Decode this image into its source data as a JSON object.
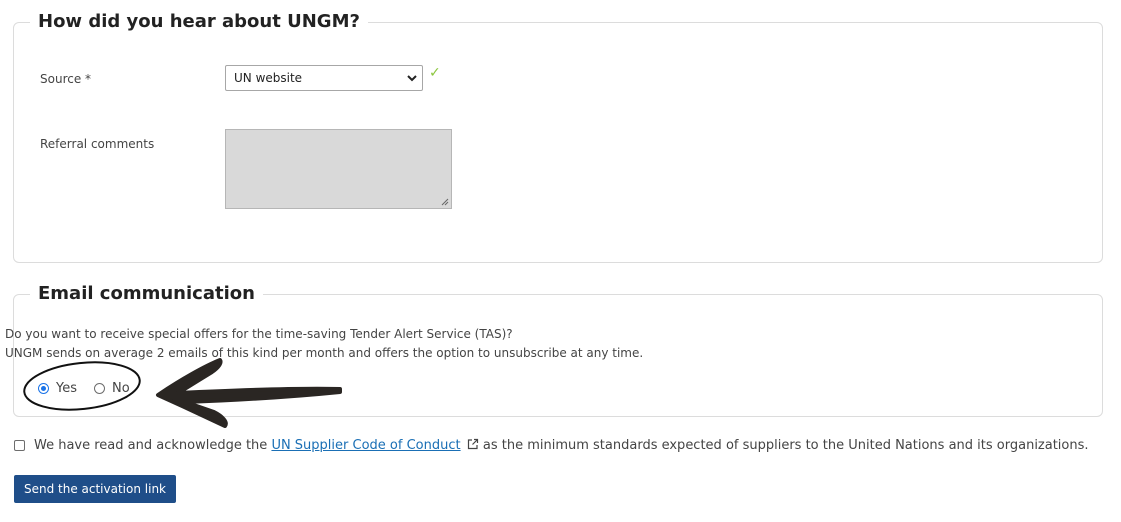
{
  "hear_section": {
    "legend": "How did you hear about UNGM?",
    "source_label": "Source *",
    "source_value": "UN website",
    "referral_label": "Referral comments",
    "referral_value": ""
  },
  "email_section": {
    "legend": "Email communication",
    "question_line1": "Do you want to receive special offers for the time-saving Tender Alert Service (TAS)?",
    "question_line2": "UNGM sends on average 2 emails of this kind per month and offers the option to unsubscribe at any time.",
    "yes_label": "Yes",
    "no_label": "No",
    "selected": "Yes"
  },
  "acknowledge": {
    "prefix": "We have read and acknowledge the ",
    "link": "UN Supplier Code of Conduct",
    "suffix": " as the minimum standards expected of suppliers to the United Nations and its organizations.",
    "checked": false
  },
  "submit_label": "Send the activation link",
  "colors": {
    "accent": "#1f4e89",
    "link": "#1a6fb5",
    "valid_check": "#8cc63f"
  }
}
